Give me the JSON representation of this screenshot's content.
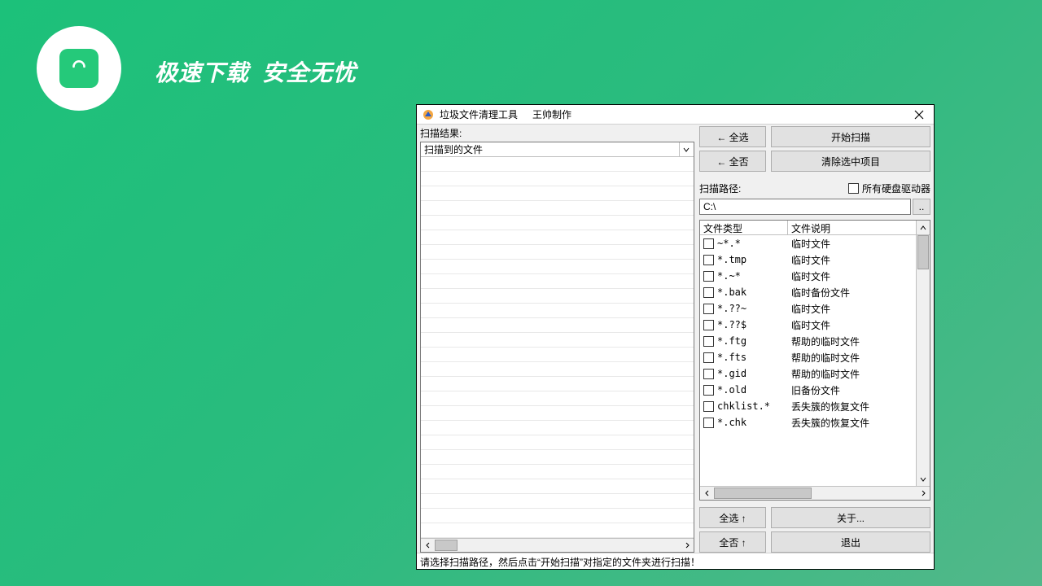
{
  "brand": {
    "slogan1": "极速下载",
    "slogan2": "安全无忧"
  },
  "window": {
    "title": "垃圾文件清理工具",
    "subtitle": "王帅制作",
    "scan_results_label": "扫描结果:",
    "result_column": "扫描到的文件",
    "buttons": {
      "select_all_top": "← 全选",
      "select_none_top": "← 全否",
      "start_scan": "开始扫描",
      "clear_selected": "清除选中项目",
      "select_all_bottom": "全选 ↑",
      "select_none_bottom": "全否 ↑",
      "about": "关于...",
      "exit": "退出"
    },
    "scan_path_label": "扫描路径:",
    "all_drives_label": "所有硬盘驱动器",
    "path_value": "C:\\",
    "browse": "..",
    "type_headers": {
      "col1": "文件类型",
      "col2": "文件说明"
    },
    "types": [
      {
        "pattern": "~*.*",
        "desc": "临时文件"
      },
      {
        "pattern": "*.tmp",
        "desc": "临时文件"
      },
      {
        "pattern": "*.~*",
        "desc": "临时文件"
      },
      {
        "pattern": "*.bak",
        "desc": "临时备份文件"
      },
      {
        "pattern": "*.??~",
        "desc": "临时文件"
      },
      {
        "pattern": "*.??$",
        "desc": "临时文件"
      },
      {
        "pattern": "*.ftg",
        "desc": "帮助的临时文件"
      },
      {
        "pattern": "*.fts",
        "desc": "帮助的临时文件"
      },
      {
        "pattern": "*.gid",
        "desc": "帮助的临时文件"
      },
      {
        "pattern": "*.old",
        "desc": "旧备份文件"
      },
      {
        "pattern": "chklist.*",
        "desc": "丢失簇的恢复文件"
      },
      {
        "pattern": "*.chk",
        "desc": "丢失簇的恢复文件"
      }
    ],
    "status": "请选择扫描路径，然后点击“开始扫描”对指定的文件夹进行扫描！"
  }
}
